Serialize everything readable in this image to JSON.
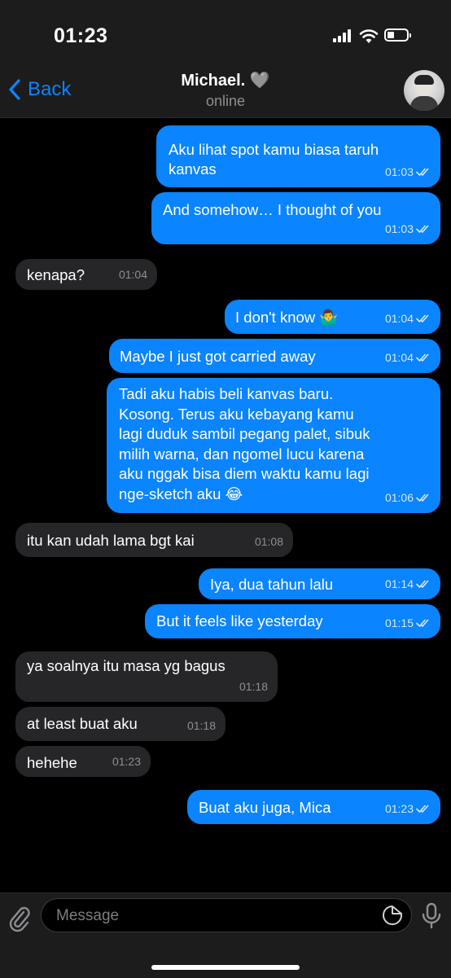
{
  "status": {
    "time": "01:23"
  },
  "header": {
    "back_label": "Back",
    "contact_name": "Michael. 🩶",
    "presence": "online"
  },
  "messages": [
    {
      "dir": "out",
      "lines": [
        "Aku lihat spot kamu biasa taruh",
        "kanvas"
      ],
      "time": "01:03"
    },
    {
      "dir": "out",
      "lines": [
        "And somehow… I thought of you"
      ],
      "time": "01:03"
    },
    {
      "dir": "in",
      "lines": [
        "kenapa?"
      ],
      "time": "01:04"
    },
    {
      "dir": "out",
      "lines": [
        "I don't know 🤷‍♂️"
      ],
      "time": "01:04"
    },
    {
      "dir": "out",
      "lines": [
        "Maybe I just got carried away"
      ],
      "time": "01:04"
    },
    {
      "dir": "out",
      "lines": [
        "Tadi aku habis beli kanvas baru.",
        "Kosong. Terus aku kebayang kamu",
        "lagi duduk sambil pegang palet, sibuk",
        "milih warna, dan ngomel lucu karena",
        "aku nggak bisa diem waktu kamu lagi",
        "nge-sketch aku 😂"
      ],
      "time": "01:06"
    },
    {
      "dir": "in",
      "lines": [
        "itu kan udah lama bgt kai"
      ],
      "time": "01:08"
    },
    {
      "dir": "out",
      "lines": [
        "Iya, dua tahun lalu"
      ],
      "time": "01:14"
    },
    {
      "dir": "out",
      "lines": [
        "But it feels like yesterday"
      ],
      "time": "01:15"
    },
    {
      "dir": "in",
      "lines": [
        "ya soalnya itu masa yg bagus"
      ],
      "time": "01:18"
    },
    {
      "dir": "in",
      "lines": [
        "at least buat aku"
      ],
      "time": "01:18"
    },
    {
      "dir": "in",
      "lines": [
        "hehehe"
      ],
      "time": "01:23"
    },
    {
      "dir": "out",
      "lines": [
        "Buat aku juga, Mica"
      ],
      "time": "01:23"
    }
  ],
  "composer": {
    "placeholder": "Message"
  },
  "colors": {
    "outgoing": "#0a84ff",
    "incoming": "#262628",
    "accent": "#0a84ff"
  },
  "icons": [
    "signal-icon",
    "wifi-icon",
    "battery-icon",
    "chevron-left-icon",
    "paperclip-icon",
    "sticker-icon",
    "microphone-icon",
    "double-check-icon"
  ]
}
